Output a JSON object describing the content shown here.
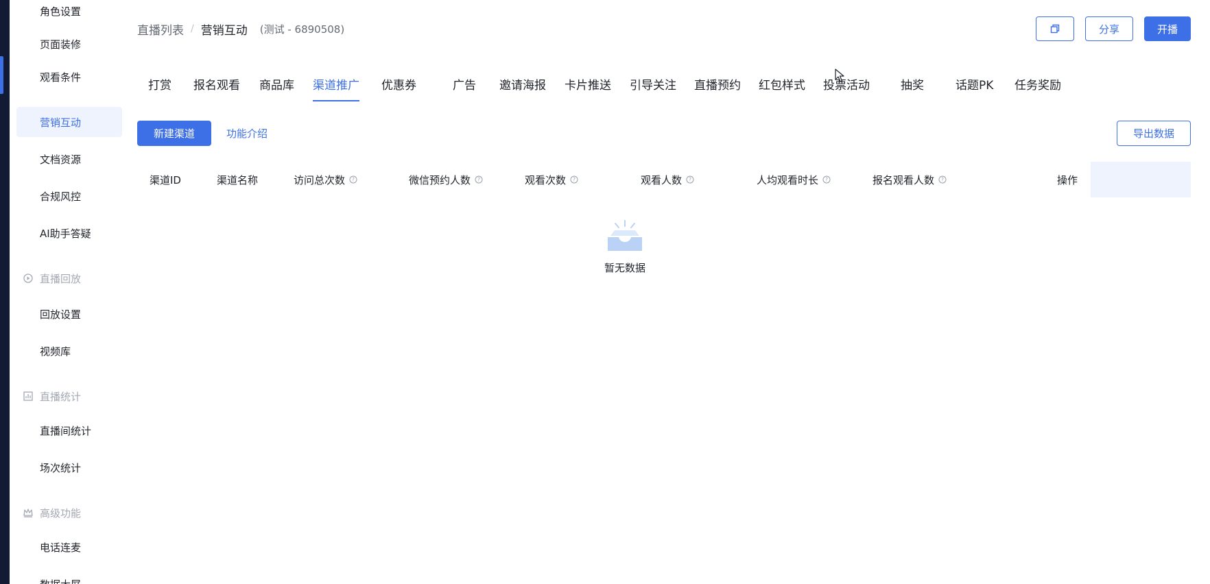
{
  "sidebar": {
    "items": [
      {
        "label": "角色设置"
      },
      {
        "label": "页面装修"
      },
      {
        "label": "观看条件"
      },
      {
        "label": "营销互动",
        "active": true
      },
      {
        "label": "文档资源"
      },
      {
        "label": "合规风控"
      },
      {
        "label": "AI助手答疑"
      }
    ],
    "groups": {
      "replay": {
        "label": "直播回放",
        "icon": "replay-icon",
        "items": [
          {
            "label": "回放设置"
          },
          {
            "label": "视频库"
          }
        ]
      },
      "stats": {
        "label": "直播统计",
        "icon": "chart-icon",
        "items": [
          {
            "label": "直播间统计"
          },
          {
            "label": "场次统计"
          }
        ]
      },
      "advanced": {
        "label": "高级功能",
        "icon": "crown-icon",
        "items": [
          {
            "label": "电话连麦"
          },
          {
            "label": "数据大屏"
          }
        ]
      }
    }
  },
  "header": {
    "breadcrumb_root": "直播列表",
    "breadcrumb_sep": "/",
    "breadcrumb_current": "营销互动",
    "subtitle": "(测试 - 6890508)",
    "copy_icon": "copy-icon",
    "share_label": "分享",
    "start_label": "开播"
  },
  "tabs": [
    {
      "label": "打赏"
    },
    {
      "label": "报名观看"
    },
    {
      "label": "商品库"
    },
    {
      "label": "渠道推广",
      "active": true
    },
    {
      "label": "优惠券"
    },
    {
      "label": "广告"
    },
    {
      "label": "邀请海报"
    },
    {
      "label": "卡片推送"
    },
    {
      "label": "引导关注"
    },
    {
      "label": "直播预约"
    },
    {
      "label": "红包样式"
    },
    {
      "label": "投票活动"
    },
    {
      "label": "抽奖"
    },
    {
      "label": "话题PK"
    },
    {
      "label": "任务奖励"
    }
  ],
  "toolbar": {
    "new_channel_label": "新建渠道",
    "intro_label": "功能介绍",
    "export_label": "导出数据"
  },
  "table": {
    "columns": [
      {
        "label": "渠道ID",
        "help": false
      },
      {
        "label": "渠道名称",
        "help": false
      },
      {
        "label": "访问总次数",
        "help": true
      },
      {
        "label": "微信预约人数",
        "help": true
      },
      {
        "label": "观看次数",
        "help": true
      },
      {
        "label": "观看人数",
        "help": true
      },
      {
        "label": "人均观看时长",
        "help": true
      },
      {
        "label": "报名观看人数",
        "help": true
      },
      {
        "label": "操作",
        "help": false
      }
    ],
    "rows": [],
    "empty_text": "暂无数据"
  },
  "colors": {
    "primary": "#3d6fe6",
    "sidebar_dark": "#121b33",
    "active_bg": "#eef3fd"
  }
}
